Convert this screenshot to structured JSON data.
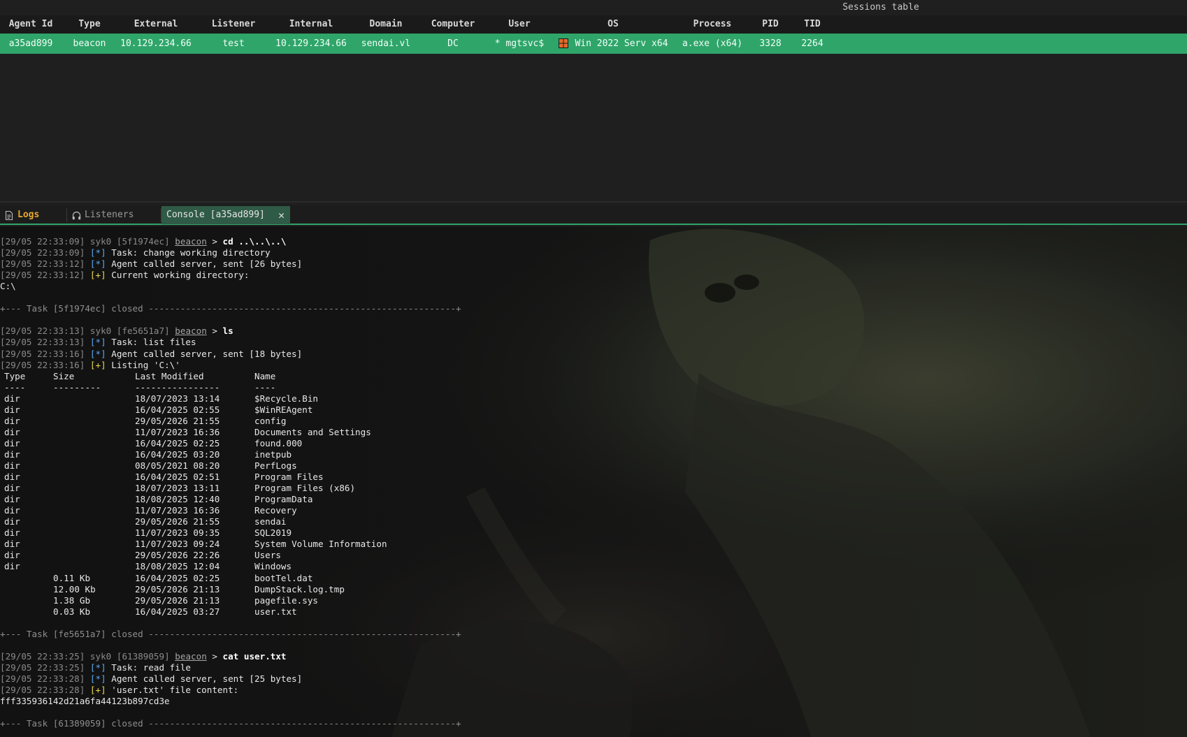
{
  "sessions_table": {
    "title": "Sessions table",
    "columns": [
      "Agent Id",
      "Type",
      "External",
      "Listener",
      "Internal",
      "Domain",
      "Computer",
      "User",
      "OS",
      "Process",
      "PID",
      "TID"
    ],
    "row": {
      "agent_id": "a35ad899",
      "type": "beacon",
      "external": "10.129.234.66",
      "listener": "test",
      "internal": "10.129.234.66",
      "domain": "sendai.vl",
      "computer": "DC",
      "user": "* mgtsvc$",
      "os_icon": "windows-icon",
      "os": "Win 2022 Serv x64",
      "process": "a.exe (x64)",
      "pid": "3328",
      "tid": "2264"
    },
    "row_color": "#2fa56a"
  },
  "tabs": [
    {
      "label": "Logs",
      "icon": "document-icon"
    },
    {
      "label": "Listeners",
      "icon": "headphones-icon"
    },
    {
      "label": "Console [a35ad899]",
      "close": "✕"
    }
  ],
  "console": {
    "op": "syk0",
    "agent_link": "beacon",
    "tasks": [
      {
        "prompt_ts": "[29/05 22:33:09]",
        "task_id": "[5f1974ec]",
        "command": "cd ..\\..\\..\\",
        "messages": [
          {
            "ts": "[29/05 22:33:09]",
            "mark": "[*]",
            "text": "Task: change working directory"
          },
          {
            "ts": "[29/05 22:33:12]",
            "mark": "[*]",
            "text": "Agent called server, sent [26 bytes]"
          },
          {
            "ts": "[29/05 22:33:12]",
            "mark": "[+]",
            "text": "Current working directory:"
          }
        ],
        "output": [
          "C:\\"
        ],
        "closed": "+--- Task [5f1974ec] closed ----------------------------------------------------------+"
      },
      {
        "prompt_ts": "[29/05 22:33:13]",
        "task_id": "[fe5651a7]",
        "command": "ls",
        "messages": [
          {
            "ts": "[29/05 22:33:13]",
            "mark": "[*]",
            "text": "Task: list files"
          },
          {
            "ts": "[29/05 22:33:16]",
            "mark": "[*]",
            "text": "Agent called server, sent [18 bytes]"
          },
          {
            "ts": "[29/05 22:33:16]",
            "mark": "[+]",
            "text": "Listing 'C:\\'"
          }
        ],
        "listing": {
          "headers": [
            "Type",
            "Size",
            "Last Modified",
            "Name"
          ],
          "dashes": [
            "----",
            "---------",
            "----------------",
            "----"
          ],
          "rows": [
            [
              "dir",
              "",
              "18/07/2023 13:14",
              "$Recycle.Bin"
            ],
            [
              "dir",
              "",
              "16/04/2025 02:55",
              "$WinREAgent"
            ],
            [
              "dir",
              "",
              "29/05/2026 21:55",
              "config"
            ],
            [
              "dir",
              "",
              "11/07/2023 16:36",
              "Documents and Settings"
            ],
            [
              "dir",
              "",
              "16/04/2025 02:25",
              "found.000"
            ],
            [
              "dir",
              "",
              "16/04/2025 03:20",
              "inetpub"
            ],
            [
              "dir",
              "",
              "08/05/2021 08:20",
              "PerfLogs"
            ],
            [
              "dir",
              "",
              "16/04/2025 02:51",
              "Program Files"
            ],
            [
              "dir",
              "",
              "18/07/2023 13:11",
              "Program Files (x86)"
            ],
            [
              "dir",
              "",
              "18/08/2025 12:40",
              "ProgramData"
            ],
            [
              "dir",
              "",
              "11/07/2023 16:36",
              "Recovery"
            ],
            [
              "dir",
              "",
              "29/05/2026 21:55",
              "sendai"
            ],
            [
              "dir",
              "",
              "11/07/2023 09:35",
              "SQL2019"
            ],
            [
              "dir",
              "",
              "11/07/2023 09:24",
              "System Volume Information"
            ],
            [
              "dir",
              "",
              "29/05/2026 22:26",
              "Users"
            ],
            [
              "dir",
              "",
              "18/08/2025 12:04",
              "Windows"
            ],
            [
              "",
              "0.11 Kb",
              "16/04/2025 02:25",
              "bootTel.dat"
            ],
            [
              "",
              "12.00 Kb",
              "29/05/2026 21:13",
              "DumpStack.log.tmp"
            ],
            [
              "",
              "1.38 Gb",
              "29/05/2026 21:13",
              "pagefile.sys"
            ],
            [
              "",
              "0.03 Kb",
              "16/04/2025 03:27",
              "user.txt"
            ]
          ]
        },
        "closed": "+--- Task [fe5651a7] closed ----------------------------------------------------------+"
      },
      {
        "prompt_ts": "[29/05 22:33:25]",
        "task_id": "[61389059]",
        "command": "cat user.txt",
        "messages": [
          {
            "ts": "[29/05 22:33:25]",
            "mark": "[*]",
            "text": "Task: read file"
          },
          {
            "ts": "[29/05 22:33:28]",
            "mark": "[*]",
            "text": "Agent called server, sent [25 bytes]"
          },
          {
            "ts": "[29/05 22:33:28]",
            "mark": "[+]",
            "text": "'user.txt' file content:"
          }
        ],
        "output": [
          "fff335936142d21a6fa44123b897cd3e"
        ],
        "closed": "+--- Task [61389059] closed ----------------------------------------------------------+"
      }
    ]
  }
}
